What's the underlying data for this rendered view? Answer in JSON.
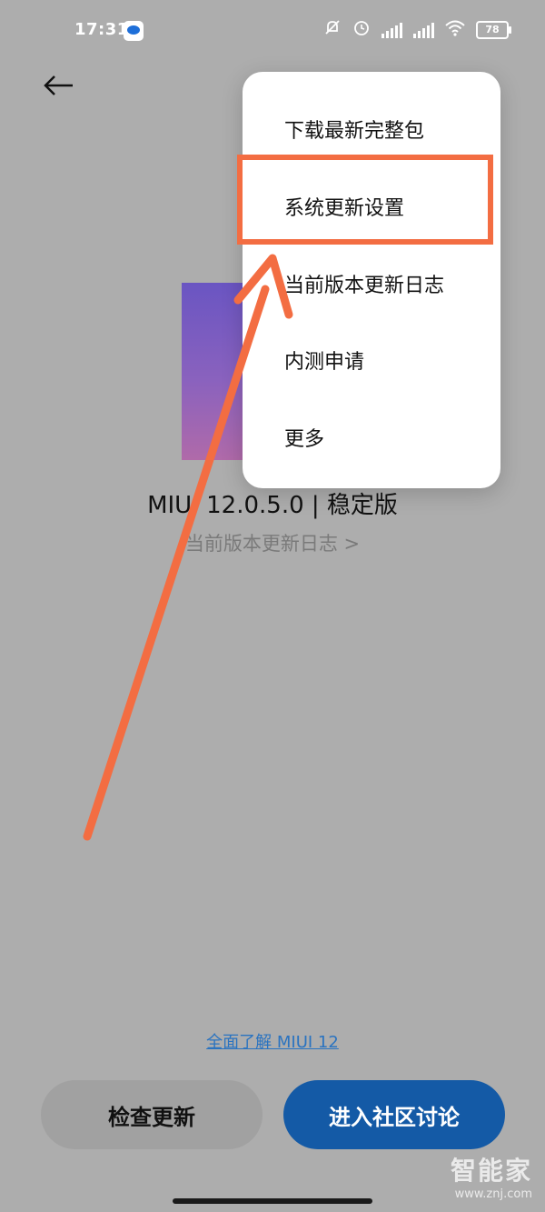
{
  "status_bar": {
    "time": "17:31",
    "battery": "78",
    "icons": [
      "mute-bell-icon",
      "alarm-icon",
      "signal-icon",
      "hd-signal-icon",
      "wifi-icon",
      "battery-icon"
    ]
  },
  "header": {
    "back_icon": "back-arrow-icon"
  },
  "version": {
    "title": "MIUI 12.0.5.0 | 稳定版",
    "changelog_link": "当前版本更新日志 >"
  },
  "menu": {
    "items": [
      {
        "label": "下载最新完整包"
      },
      {
        "label": "系统更新设置"
      },
      {
        "label": "当前版本更新日志"
      },
      {
        "label": "内测申请"
      },
      {
        "label": "更多"
      }
    ],
    "highlighted_index": 1
  },
  "footer": {
    "learn_more": "全面了解 MIUI 12",
    "check_update": "检查更新",
    "community": "进入社区讨论"
  },
  "watermark": {
    "cn": "智能家",
    "url": "www.znj.com"
  },
  "colors": {
    "background": "#adadad",
    "accent": "#145aa6",
    "annotation": "#f36d42"
  }
}
